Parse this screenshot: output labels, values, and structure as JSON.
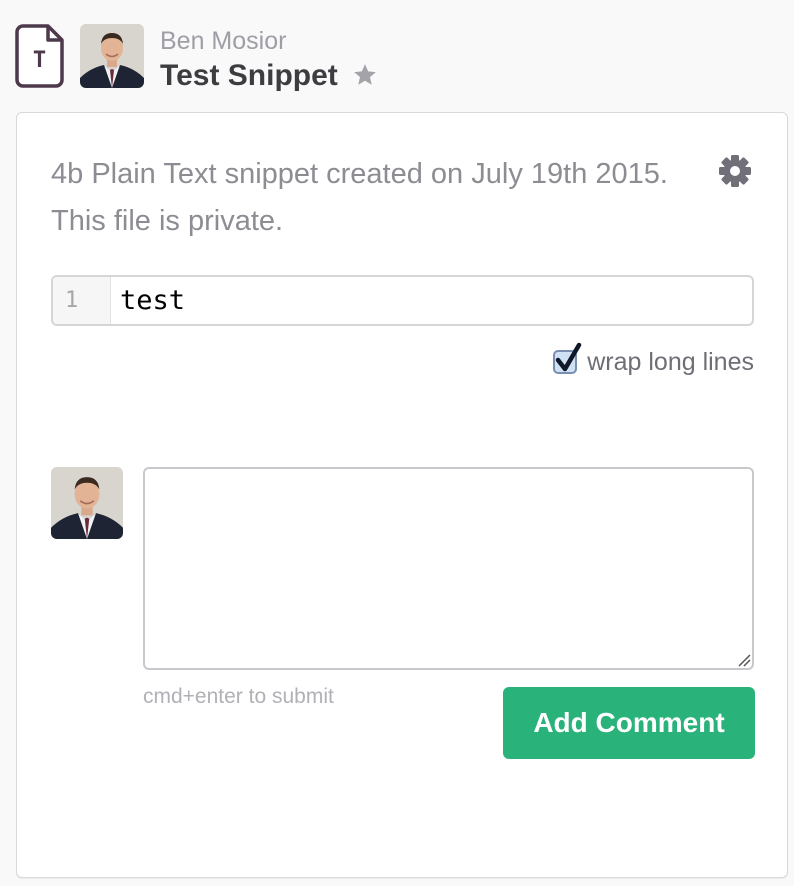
{
  "header": {
    "filetype_letter": "T",
    "author": "Ben Mosior",
    "title": "Test Snippet"
  },
  "snippet": {
    "meta": "4b Plain Text snippet created on July 19th 2015. This file is private.",
    "lines": [
      {
        "number": "1",
        "text": "test"
      }
    ],
    "wrap_label": "wrap long lines",
    "wrap_checked": true
  },
  "comment": {
    "value": "",
    "hint": "cmd+enter to submit",
    "submit_label": "Add Comment"
  },
  "colors": {
    "accent_green": "#2ab27b",
    "filetype_icon": "#4d394b"
  },
  "icons": [
    "text-file-icon",
    "star-icon",
    "gear-icon",
    "checkmark-icon",
    "resize-grip-icon"
  ]
}
